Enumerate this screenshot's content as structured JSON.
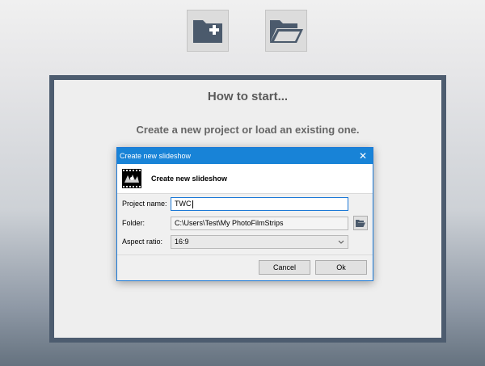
{
  "toolbar": {
    "new_project_icon": "folder-plus-icon",
    "open_project_icon": "folder-open-icon"
  },
  "start": {
    "title": "How to start...",
    "subtitle": "Create a new project or load an existing one."
  },
  "dialog": {
    "window_title": "Create new slideshow",
    "close_glyph": "✕",
    "header_title": "Create new slideshow",
    "fields": {
      "project_name_label": "Project name:",
      "project_name_value": "TWC",
      "folder_label": "Folder:",
      "folder_value": "C:\\Users\\Test\\My PhotoFilmStrips",
      "aspect_label": "Aspect ratio:",
      "aspect_value": "16:9"
    },
    "buttons": {
      "cancel": "Cancel",
      "ok": "Ok"
    }
  },
  "colors": {
    "titlebar": "#1883d7",
    "panel_border": "#4d5c6f",
    "folder_icon": "#4b5a6c"
  }
}
